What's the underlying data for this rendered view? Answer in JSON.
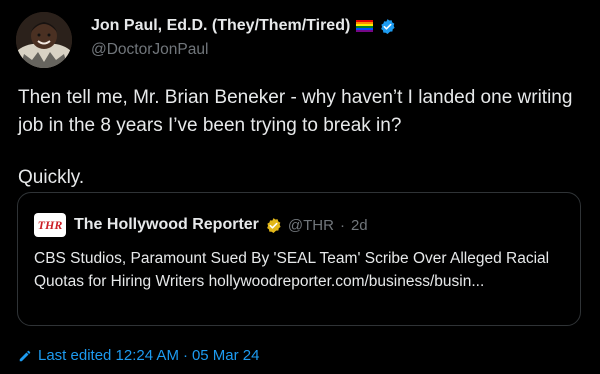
{
  "author": {
    "display_name": "Jon Paul, Ed.D. (They/Them/Tired)",
    "handle": "@DoctorJonPaul",
    "avatar_icon": "profile-avatar",
    "flag_icon": "rainbow-flag-icon",
    "verified_icon": "blue-verified-icon"
  },
  "tweet": {
    "line1": "Then tell me, Mr. Brian Beneker - why haven’t I landed one writing job in the 8 years I’ve been trying to break in?",
    "line2": "Quickly."
  },
  "quote": {
    "logo_text": "THR",
    "name": "The Hollywood Reporter",
    "handle": "@THR",
    "separator": "·",
    "time": "2d",
    "text": "CBS Studios, Paramount Sued By 'SEAL Team' Scribe Over Alleged Racial Quotas for Hiring Writers hollywoodreporter.com/business/busin..."
  },
  "footer": {
    "edited_label": "Last edited 12:24 AM",
    "separator": "·",
    "date": "05 Mar 24"
  },
  "colors": {
    "background": "#000000",
    "text": "#e7e9ea",
    "muted": "#71767b",
    "accent": "#1d9bf0",
    "border": "#2f3336",
    "gold_verified": "#e2b719",
    "thr_red": "#cc1f26"
  }
}
